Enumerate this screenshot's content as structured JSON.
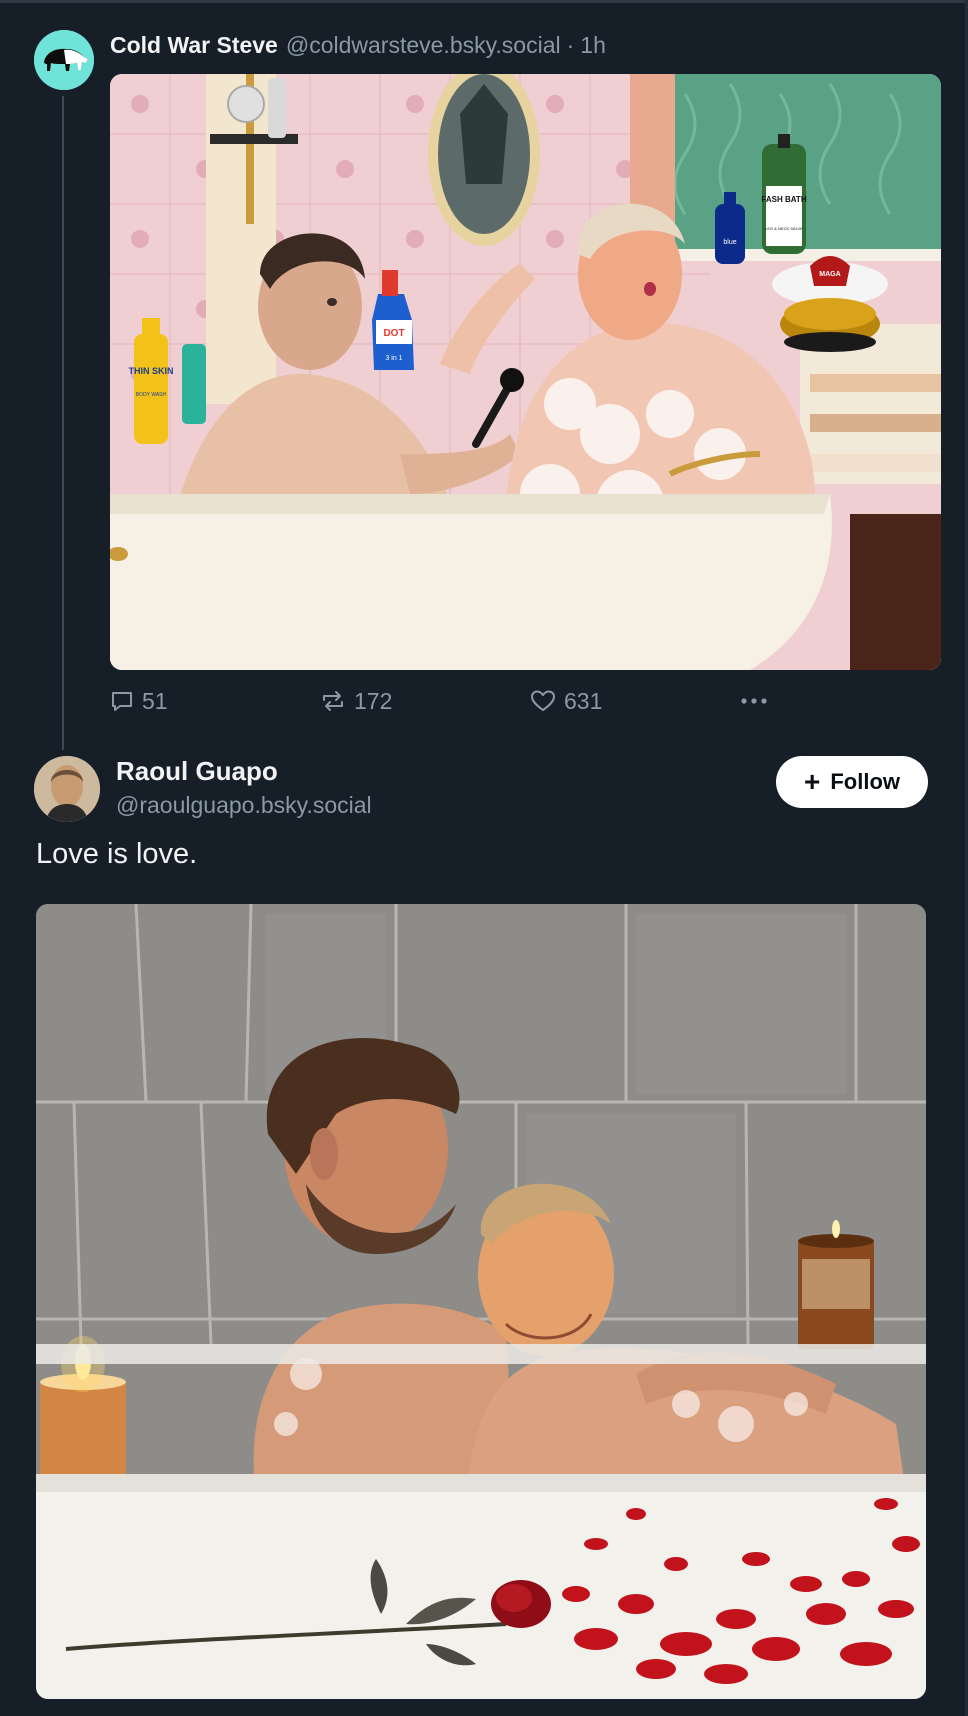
{
  "post1": {
    "author_name": "Cold War Steve",
    "author_handle": "@coldwarsteve.bsky.social",
    "separator": "·",
    "timestamp": "1h",
    "avatar_icon": "tapir-logo",
    "media": {
      "bottle_thin_skin": "THIN SKIN",
      "bottle_thin_skin_sub": "BODY WASH",
      "bottle_dot": "DOT",
      "bottle_dot_sub": "3 in 1",
      "bottle_fash": "FASH BATH",
      "bottle_fash_sub": "LEG & NECK SALVE",
      "bottle_blue": "blue",
      "cap_badge": "MAGA"
    },
    "stats": {
      "replies": "51",
      "reposts": "172",
      "likes": "631"
    },
    "icons": {
      "reply": "reply-icon",
      "repost": "repost-icon",
      "like": "heart-icon",
      "more": "more-icon"
    }
  },
  "post2": {
    "author_name": "Raoul Guapo",
    "author_handle": "@raoulguapo.bsky.social",
    "follow_label": "Follow",
    "follow_icon": "+",
    "text": "Love is love."
  },
  "colors": {
    "background": "#161e27",
    "secondary_text": "#8b98a8",
    "avatar_teal": "#6fe3d8",
    "thread_line": "#3b4a5a"
  }
}
